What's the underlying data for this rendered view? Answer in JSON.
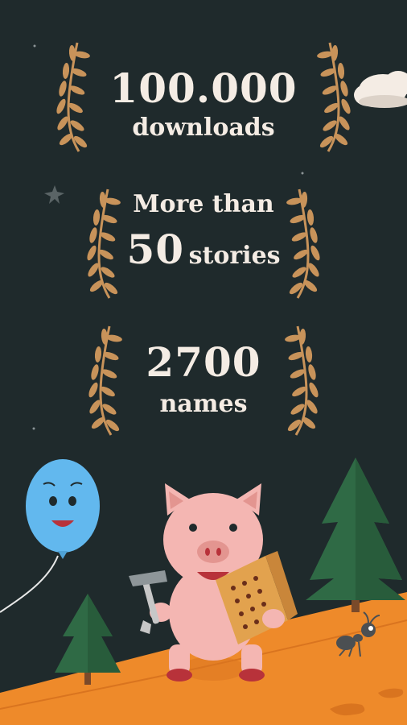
{
  "awards": [
    {
      "line1": "100.000",
      "line2": "downloads"
    },
    {
      "line1": "More than",
      "number": "50",
      "line2": "stories"
    },
    {
      "line1": "2700",
      "line2": "names"
    }
  ],
  "colors": {
    "background": "#1f2a2c",
    "text": "#f4ece4",
    "laurel": "#c8935a",
    "ground": "#ee8a2a",
    "pig": "#f4b6b2",
    "balloon": "#62b8ee",
    "tree": "#2f6a45"
  },
  "icons": [
    "laurel-wreath-icon",
    "star-icon",
    "cloud-icon",
    "balloon-character",
    "pig-character",
    "hammer-icon",
    "brick-icon",
    "tree-icon",
    "ant-character"
  ]
}
